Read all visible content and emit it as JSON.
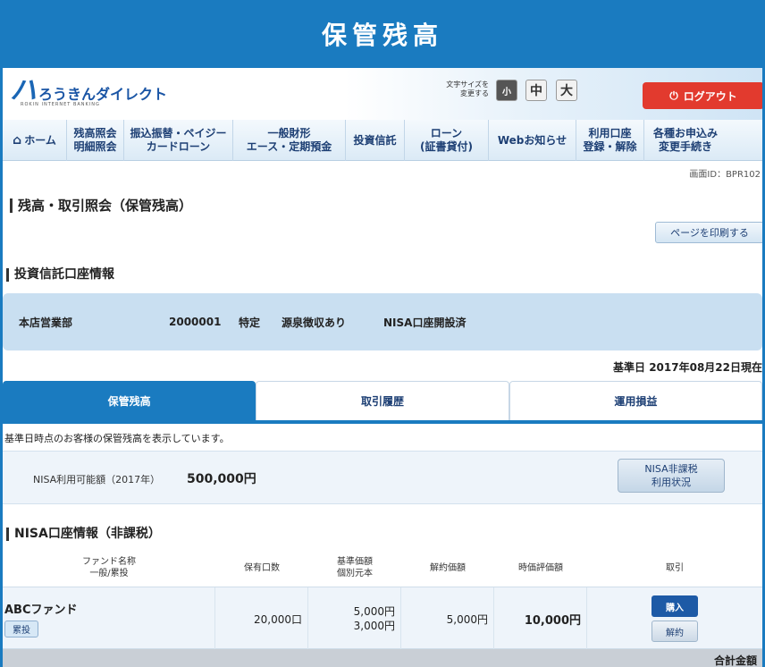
{
  "title": "保管残高",
  "header": {
    "logo_mark": "ハ",
    "logo_text": "ろうきんダイレクト",
    "logo_sub": "ROKIN INTERNET BANKING",
    "fontsize_label_1": "文字サイズを",
    "fontsize_label_2": "変更する",
    "fontsize_small": "小",
    "fontsize_mid": "中",
    "fontsize_large": "大",
    "logout": "ログアウト"
  },
  "nav": [
    {
      "line1": "ホーム",
      "line2": ""
    },
    {
      "line1": "残高照会",
      "line2": "明細照会"
    },
    {
      "line1": "振込振替・ペイジー",
      "line2": "カードローン"
    },
    {
      "line1": "一般財形",
      "line2": "エース・定期預金"
    },
    {
      "line1": "投資信託",
      "line2": ""
    },
    {
      "line1": "ローン",
      "line2": "(証書貸付)"
    },
    {
      "line1": "Webお知らせ",
      "line2": ""
    },
    {
      "line1": "利用口座",
      "line2": "登録・解除"
    },
    {
      "line1": "各種お申込み",
      "line2": "変更手続き"
    }
  ],
  "screen_id": "画面ID：BPR102",
  "page_title": "残高・取引照会（保管残高）",
  "print_button": "ページを印刷する",
  "account_section_title": "投資信託口座情報",
  "account": {
    "branch": "本店営業部",
    "number": "2000001",
    "type": "特定",
    "tax": "源泉徴収あり",
    "nisa": "NISA口座開設済"
  },
  "base_date": "基準日 2017年08月22日現在",
  "tabs": [
    {
      "label": "保管残高",
      "active": true
    },
    {
      "label": "取引履歴",
      "active": false
    },
    {
      "label": "運用損益",
      "active": false
    }
  ],
  "notice": "基準日時点のお客様の保管残高を表示しています。",
  "nisa": {
    "label": "NISA利用可能額（2017年）",
    "amount": "500,000円",
    "button_line1": "NISA非課税",
    "button_line2": "利用状況"
  },
  "nisa_section_title": "NISA口座情報（非課税）",
  "table": {
    "headers": {
      "fund_line1": "ファンド名称",
      "fund_line2": "一般/累投",
      "units": "保有口数",
      "price_line1": "基準価額",
      "price_line2": "個別元本",
      "cancel_price": "解約価額",
      "market_value": "時価評価額",
      "action": "取引"
    },
    "rows": [
      {
        "fund": "ABCファンド",
        "badge": "累投",
        "units": "20,000口",
        "base_price": "5,000円",
        "principal": "3,000円",
        "cancel_price": "5,000円",
        "market_value": "10,000円",
        "buy": "購入",
        "sell": "解約"
      }
    ]
  },
  "total_label": "合計金額"
}
